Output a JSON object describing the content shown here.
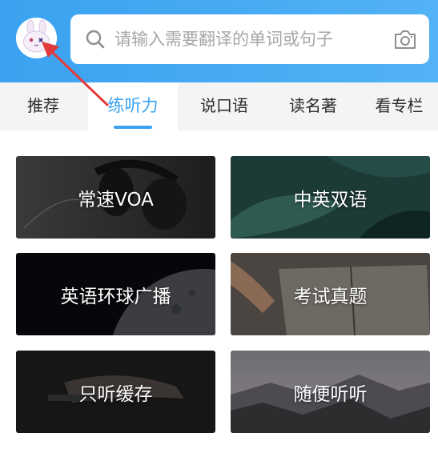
{
  "search": {
    "placeholder": "请输入需要翻译的单词或句子"
  },
  "tabs": [
    {
      "label": "推荐"
    },
    {
      "label": "练听力"
    },
    {
      "label": "说口语"
    },
    {
      "label": "读名著"
    },
    {
      "label": "看专栏"
    }
  ],
  "cards": [
    {
      "label": "常速VOA"
    },
    {
      "label": "中英双语"
    },
    {
      "label": "英语环球广播"
    },
    {
      "label": "考试真题"
    },
    {
      "label": "只听缓存"
    },
    {
      "label": "随便听听"
    }
  ],
  "colors": {
    "accent": "#3aa2f0",
    "header_start": "#3aa2f0",
    "header_end": "#52b2f5",
    "arrow": "#e23b3b"
  },
  "icons": {
    "avatar": "bunny-avatar-icon",
    "search": "search-icon",
    "camera": "camera-icon"
  }
}
